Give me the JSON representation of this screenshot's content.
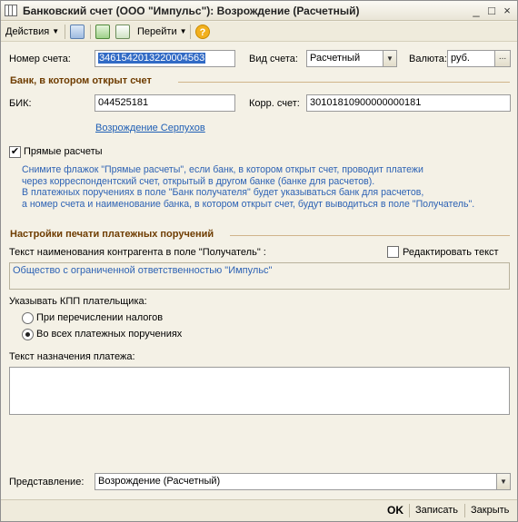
{
  "window": {
    "title": "Банковский счет (ООО \"Импульс\"): Возрождение (Расчетный)",
    "controls": [
      "_",
      "□",
      "×"
    ]
  },
  "toolbar": {
    "actions_label": "Действия",
    "goto_label": "Перейти",
    "help_glyph": "?"
  },
  "account": {
    "number_label": "Номер счета:",
    "number_value": "3461542013220004563",
    "type_label": "Вид счета:",
    "type_value": "Расчетный",
    "currency_label": "Валюта:",
    "currency_value": "руб.",
    "currency_button": "..."
  },
  "bank_section": {
    "title": "Банк, в котором открыт счет",
    "bik_label": "БИК:",
    "bik_value": "044525181",
    "corr_label": "Корр. счет:",
    "corr_value": "30101810900000000181",
    "bank_link": "Возрождение Серпухов"
  },
  "direct": {
    "checkbox_label": "Прямые расчеты",
    "checked": true,
    "info_lines": [
      "Снимите флажок \"Прямые расчеты\", если банк, в котором открыт счет, проводит платежи",
      "через корреспондентский счет, открытый в другом банке (банке для расчетов).",
      "В платежных поручениях в поле \"Банк получателя\" будет указываться банк для расчетов,",
      "а номер счета и наименование банка, в котором открыт счет, будут выводиться в поле \"Получатель\"."
    ]
  },
  "print_section": {
    "title": "Настройки печати платежных поручений",
    "recipient_text_label": "Текст наименования контрагента в поле \"Получатель\" :",
    "edit_text_label": "Редактировать текст",
    "recipient_text_value": "Общество с ограниченной ответственностью \"Импульс\"",
    "kpp_label": "Указывать КПП плательщика:",
    "kpp_option_taxes": "При перечислении налогов",
    "kpp_option_all": "Во всех платежных поручениях",
    "kpp_selected": "all",
    "purpose_label": "Текст назначения платежа:",
    "purpose_value": ""
  },
  "representation": {
    "label": "Представление:",
    "value": "Возрождение (Расчетный)"
  },
  "footer": {
    "ok_label": "OK",
    "save_label": "Записать",
    "close_label": "Закрыть"
  },
  "colors": {
    "section_title": "#6e3c00",
    "info_text": "#2d62b4",
    "link": "#1f5fb5",
    "selection": "#316ac5",
    "background": "#f4f1e6"
  }
}
